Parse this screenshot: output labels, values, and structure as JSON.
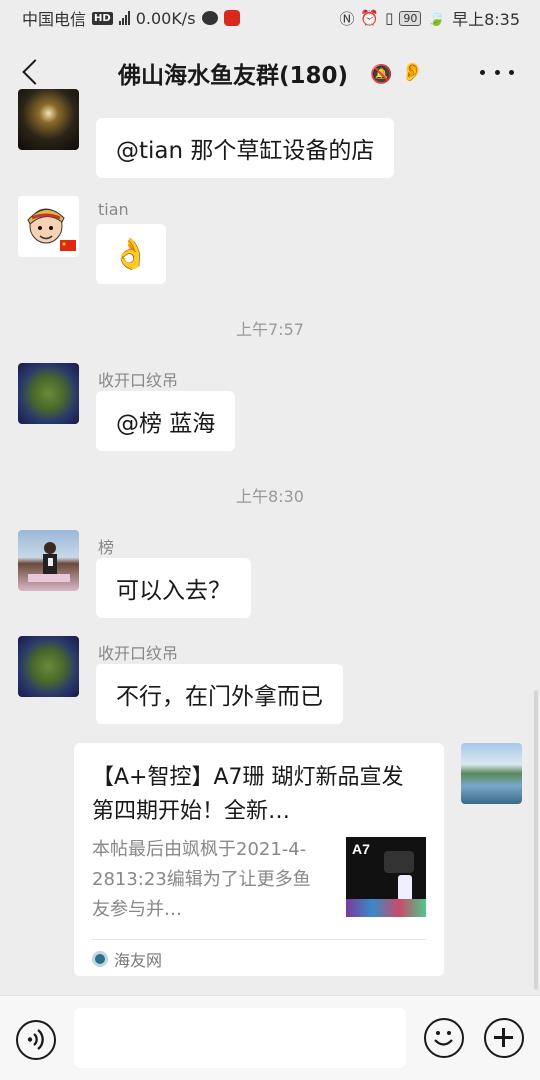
{
  "status_bar": {
    "carrier": "中国电信",
    "hd": "HD",
    "network": "4G",
    "speed": "0.00K/s",
    "battery": "90",
    "time": "早上8:35"
  },
  "header": {
    "title": "佛山海水鱼友群(180)"
  },
  "messages": [
    {
      "type": "text",
      "sender": "",
      "text": "@tian  那个草缸设备的店"
    },
    {
      "type": "emoji",
      "sender": "tian",
      "text": "👌"
    },
    {
      "type": "time",
      "text": "上午7:57"
    },
    {
      "type": "text",
      "sender": "收开口纹吊",
      "text": "@榜  蓝海"
    },
    {
      "type": "time",
      "text": "上午8:30"
    },
    {
      "type": "text",
      "sender": "榜",
      "text": "可以入去？"
    },
    {
      "type": "text",
      "sender": "收开口纹吊",
      "text": "不行，在门外拿而已"
    }
  ],
  "card": {
    "title": "【A+智控】A7珊 瑚灯新品宣发  第四期开始！全新…",
    "description": "本帖最后由飒枫于2021-4-2813:23编辑为了让更多鱼友参与并…",
    "thumb_label": "A7",
    "source": "海友网"
  },
  "colors": {
    "background": "#ededed",
    "bubble": "#ffffff",
    "text": "#191919",
    "muted": "#888888"
  }
}
